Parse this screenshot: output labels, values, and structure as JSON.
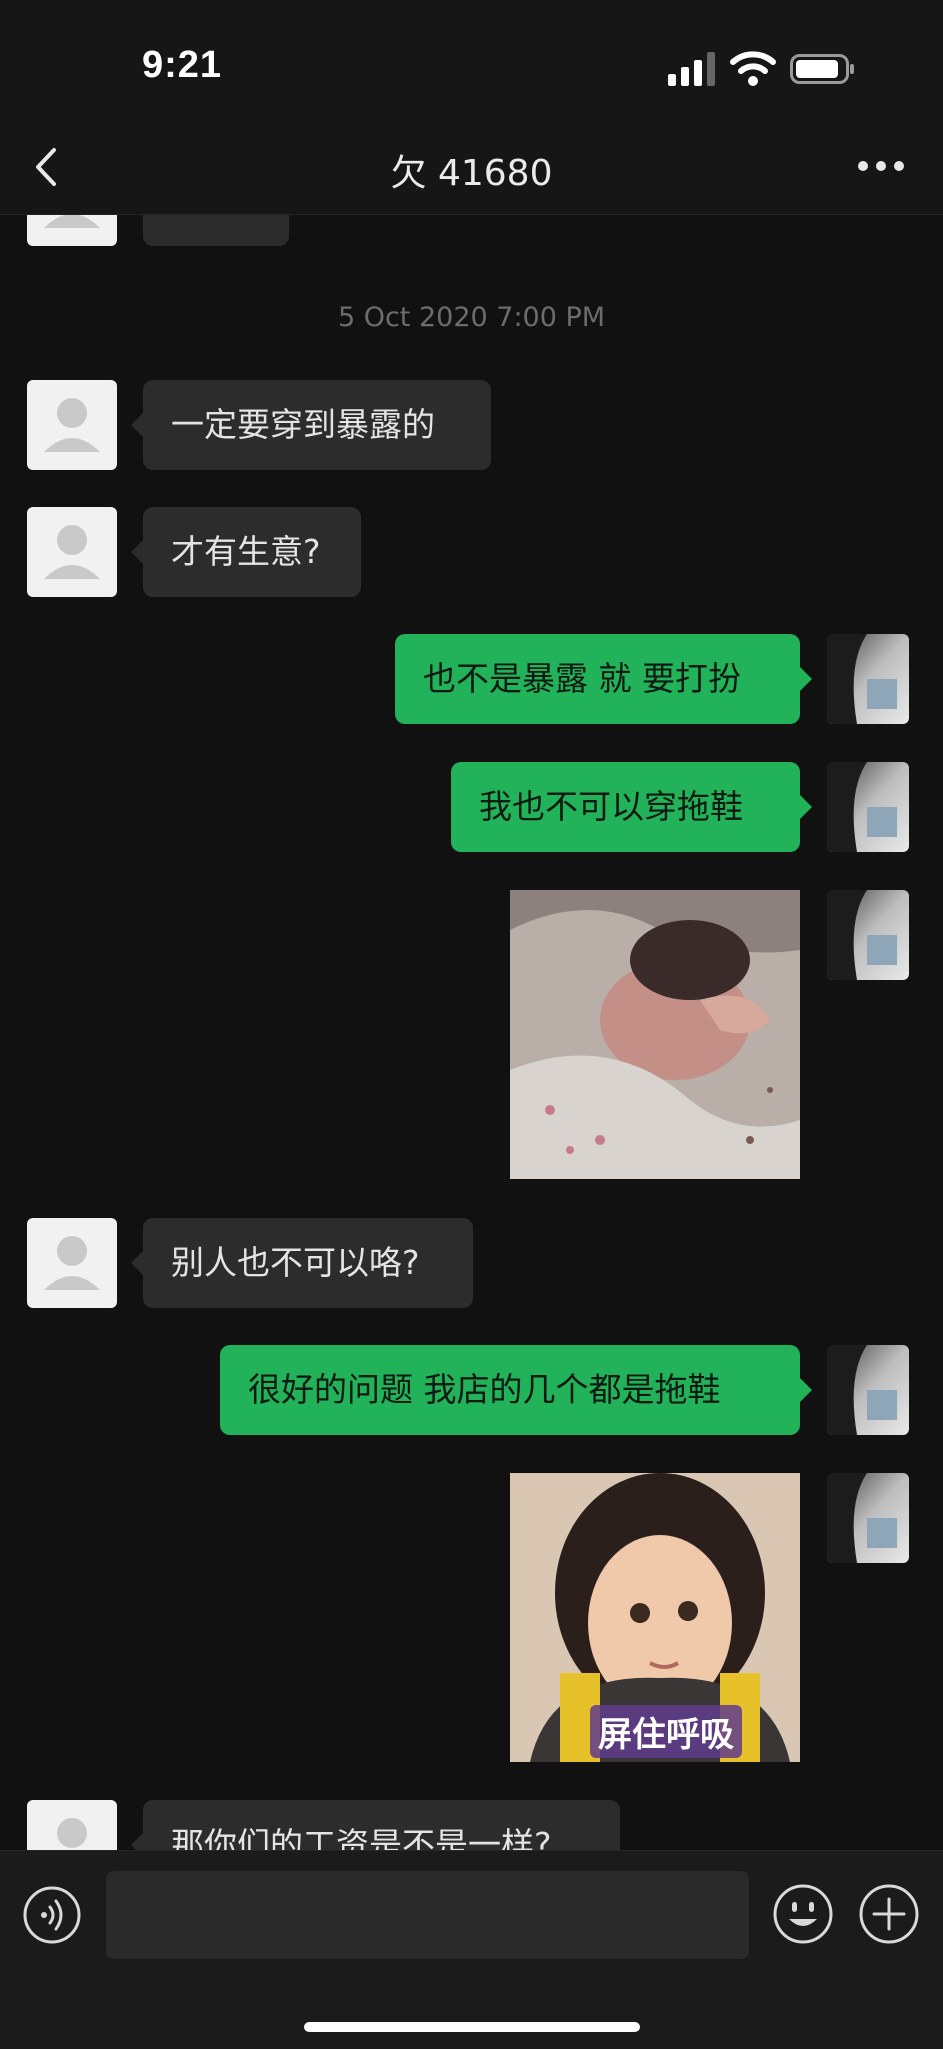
{
  "status_bar": {
    "time": "9:21"
  },
  "header": {
    "title": "欠 41680"
  },
  "timestamp": "5 Oct 2020 7:00 PM",
  "messages": [
    {
      "text": "一定要穿到暴露的"
    },
    {
      "text": "才有生意?"
    },
    {
      "text": "也不是暴露 就 要打扮"
    },
    {
      "text": "我也不可以穿拖鞋"
    },
    {
      "text": "别人也不可以咯?"
    },
    {
      "text": "很好的问题 我店的几个都是拖鞋"
    },
    {
      "text": "那你们的工资是不是一样?"
    }
  ],
  "stickers": {
    "second_caption": "屏住呼吸"
  },
  "colors": {
    "background": "#111111",
    "incoming_bubble": "#2c2c2c",
    "outgoing_bubble": "#22b35a"
  },
  "icons": [
    "back-chevron-icon",
    "more-icon",
    "voice-icon",
    "emoji-icon",
    "plus-icon",
    "signal-icon",
    "wifi-icon",
    "battery-icon"
  ]
}
